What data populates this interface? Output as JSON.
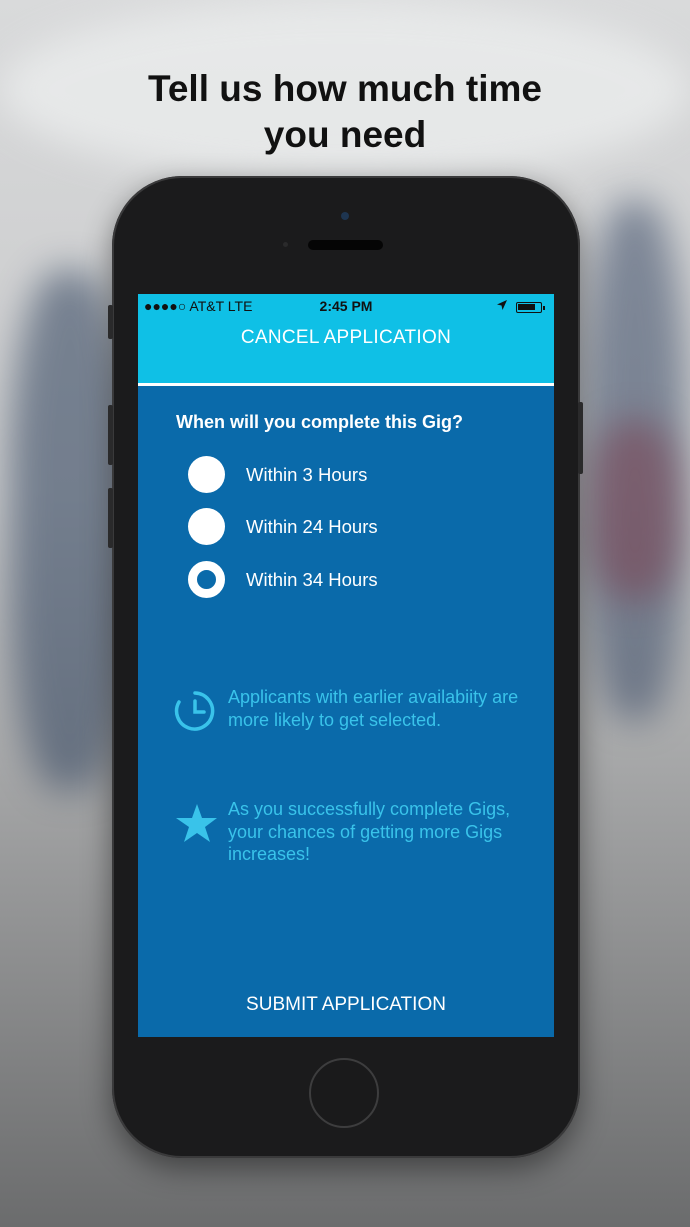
{
  "headline": {
    "line1": "Tell us how much time",
    "line2": "you need"
  },
  "status_bar": {
    "carrier": "●●●●○ AT&T  LTE",
    "time": "2:45 PM",
    "location_icon": "location-arrow-icon",
    "battery_level": 0.85
  },
  "topbar": {
    "cancel_label": "CANCEL APPLICATION"
  },
  "form": {
    "question": "When will you complete this Gig?",
    "options": [
      {
        "label": "Within 3 Hours",
        "selected": false
      },
      {
        "label": "Within 24 Hours",
        "selected": false
      },
      {
        "label": "Within 34 Hours",
        "selected": true
      }
    ]
  },
  "tips": [
    {
      "icon": "clock-icon",
      "text": "Applicants with earlier availabiity are more likely to get selected."
    },
    {
      "icon": "star-icon",
      "text": "As you successfully complete Gigs, your chances of getting more Gigs increases!"
    }
  ],
  "submit_label": "SUBMIT APPLICATION",
  "colors": {
    "accent": "#0fc0e6",
    "screen_bg": "#0a6aaa",
    "tip_text": "#39c3ea"
  }
}
